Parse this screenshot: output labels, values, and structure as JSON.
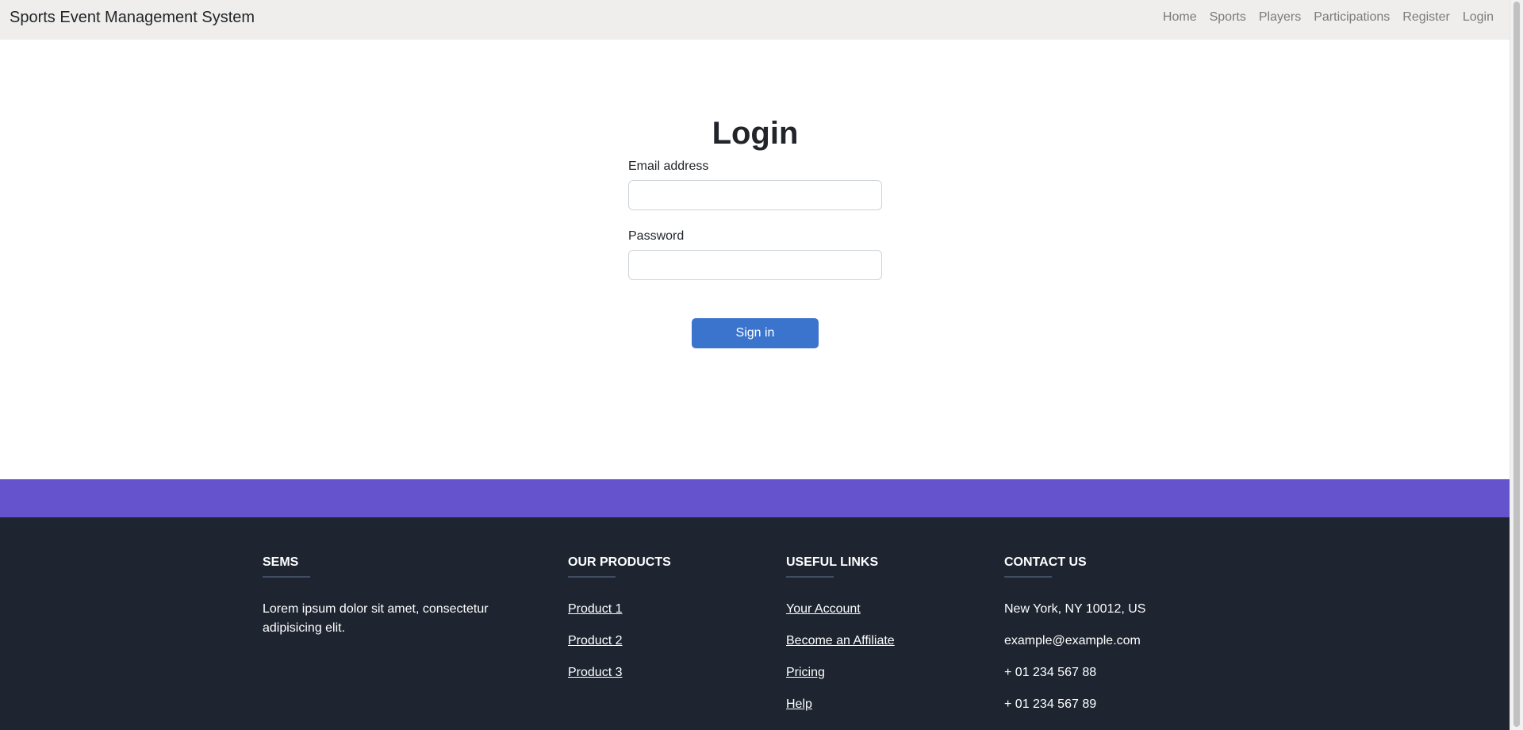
{
  "navbar": {
    "brand": "Sports Event Management System",
    "links": [
      "Home",
      "Sports",
      "Players",
      "Participations",
      "Register",
      "Login"
    ]
  },
  "login": {
    "title": "Login",
    "email_label": "Email address",
    "email_value": "",
    "password_label": "Password",
    "password_value": "",
    "submit_label": "Sign in"
  },
  "footer": {
    "about": {
      "heading": "SEMS",
      "text": "Lorem ipsum dolor sit amet, consectetur adipisicing elit."
    },
    "products": {
      "heading": "Our products",
      "items": [
        "Product 1",
        "Product 2",
        "Product 3"
      ]
    },
    "useful_links": {
      "heading": "Useful links",
      "items": [
        "Your Account",
        "Become an Affiliate",
        "Pricing",
        "Help"
      ]
    },
    "contact": {
      "heading": "Contact us",
      "items": [
        "New York, NY 10012, US",
        "example@example.com",
        "+ 01 234 567 88",
        "+ 01 234 567 89"
      ]
    }
  },
  "colors": {
    "navbar_bg": "#efeeec",
    "primary_button": "#3b74cc",
    "band": "#6553cd",
    "footer_bg": "#1e2430"
  }
}
